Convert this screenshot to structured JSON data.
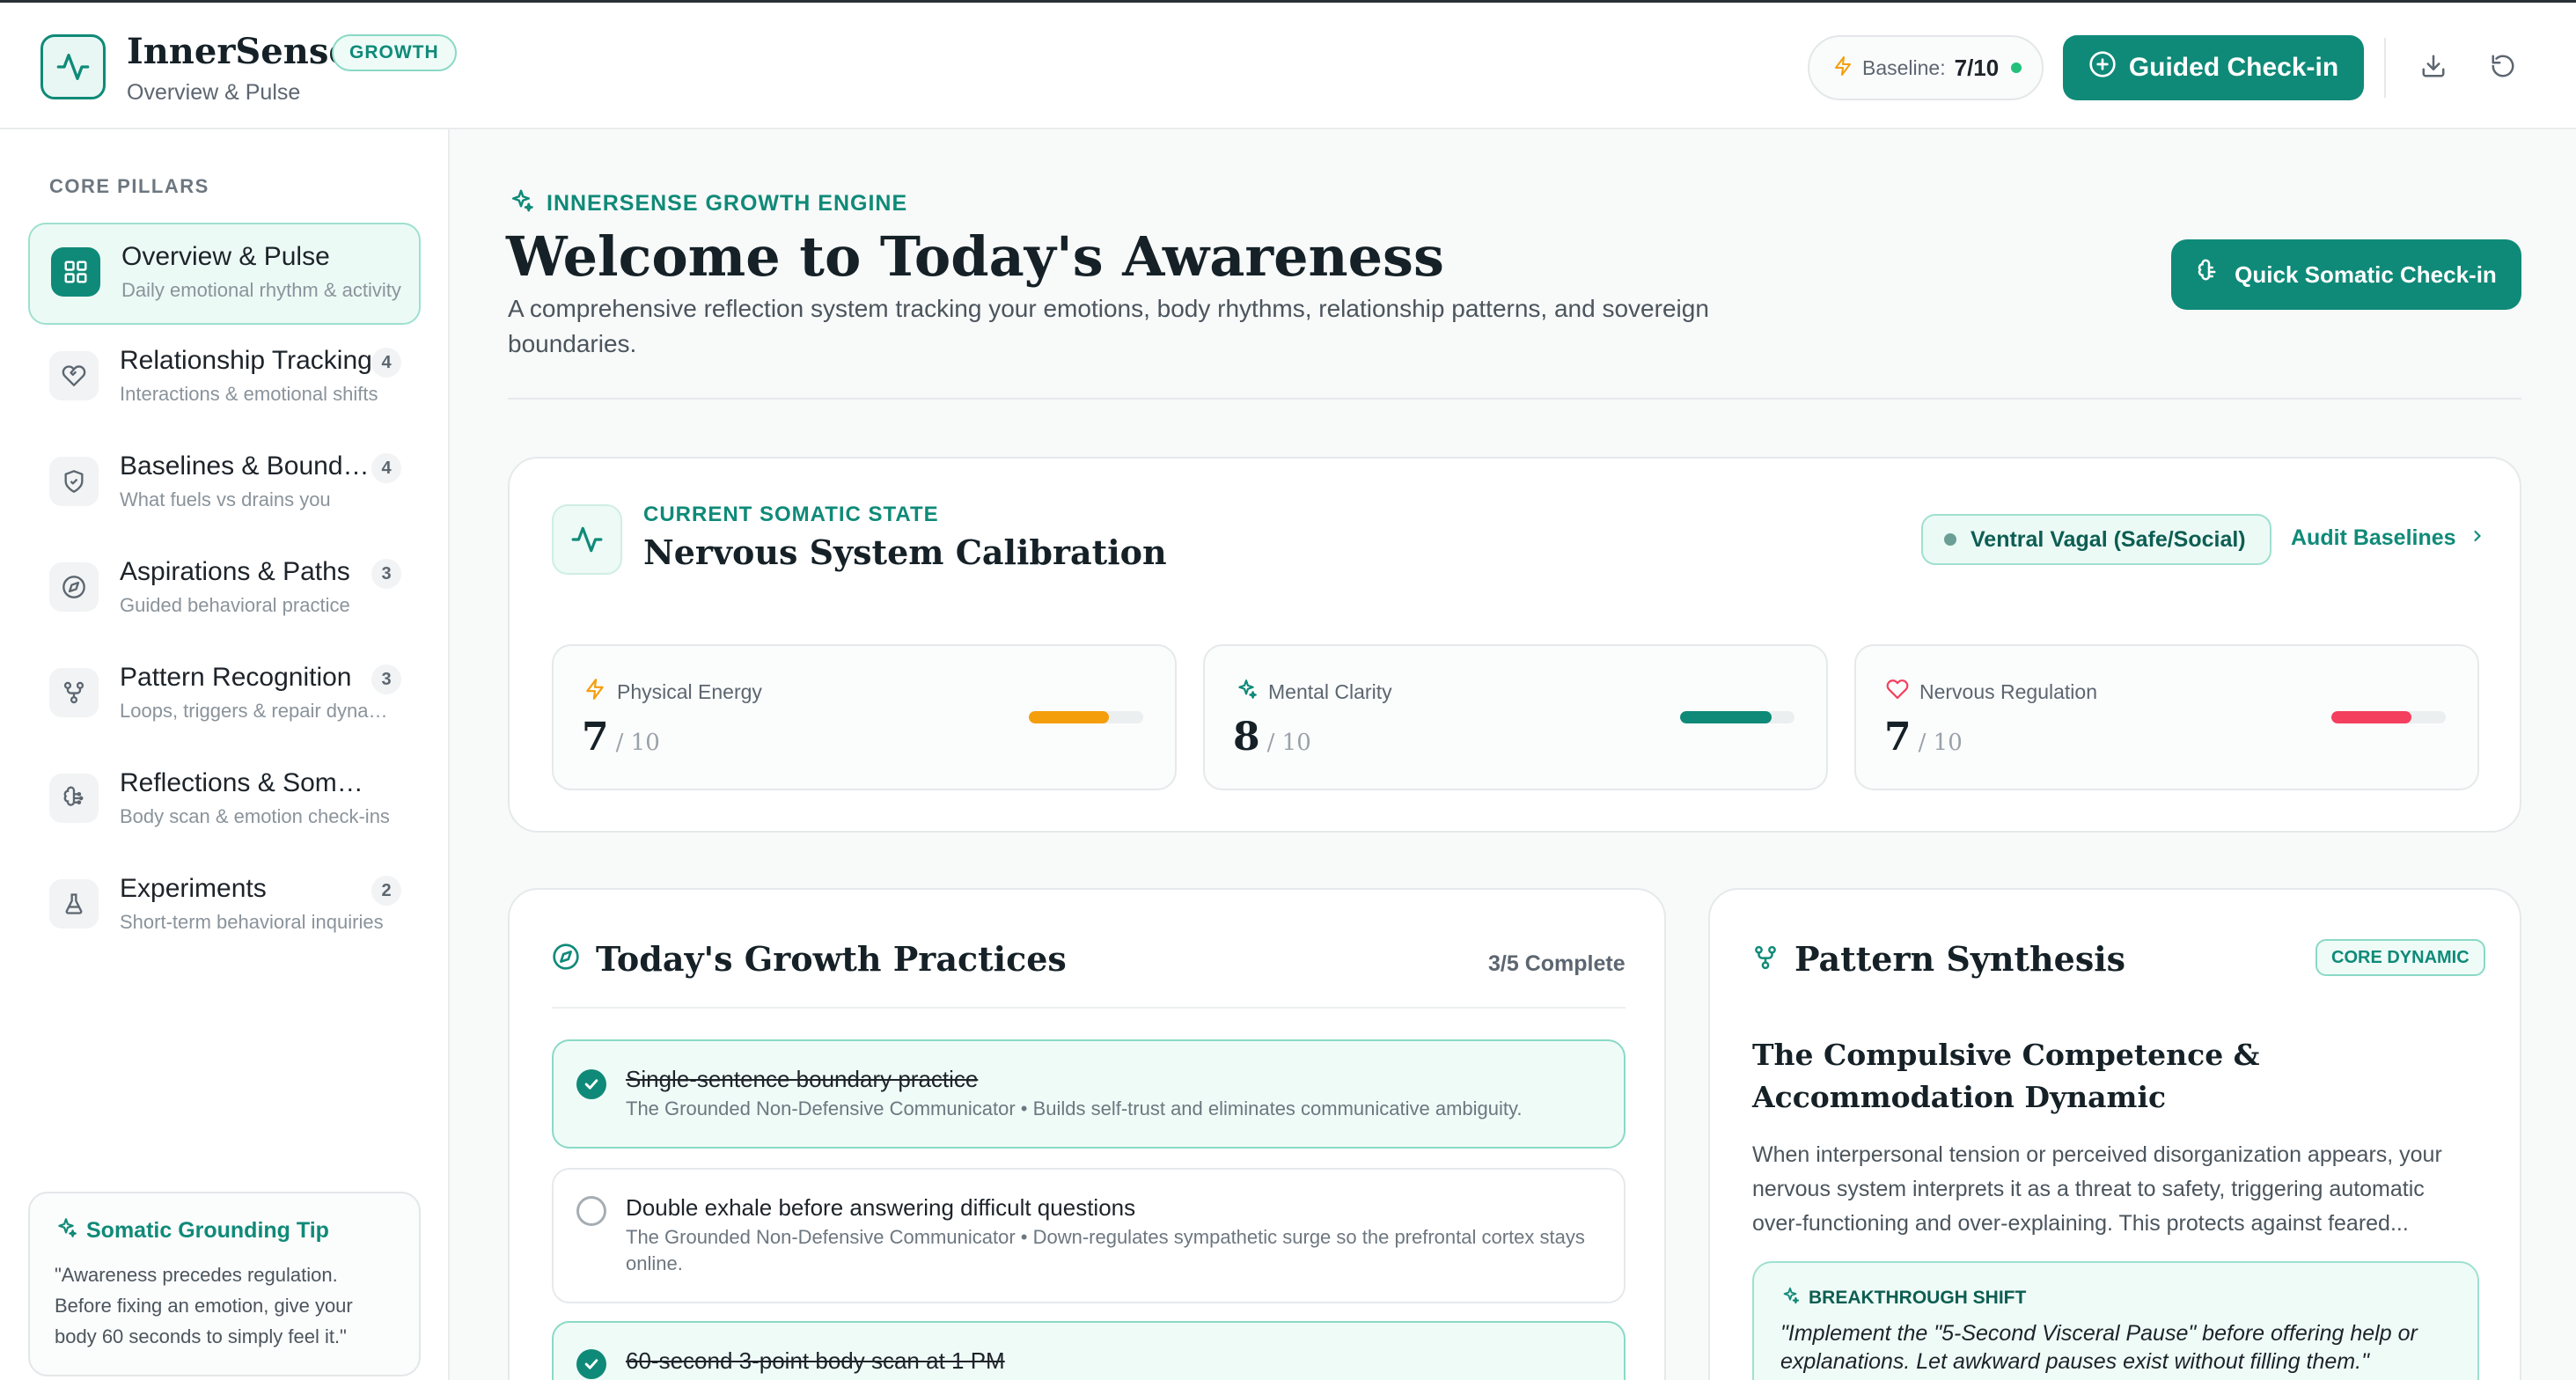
{
  "header": {
    "brand": "InnerSense",
    "badge": "GROWTH",
    "subtitle": "Overview & Pulse",
    "baseline_label": "Baseline:",
    "baseline_value": "7/10",
    "guided_button": "Guided Check-in",
    "icons": [
      "activity-icon",
      "bolt-icon",
      "plus-circle-icon",
      "download-icon",
      "refresh-icon"
    ]
  },
  "sidebar": {
    "heading": "CORE PILLARS",
    "items": [
      {
        "title": "Overview & Pulse",
        "desc": "Daily emotional rhythm & activity",
        "count": "",
        "icon": "grid-icon"
      },
      {
        "title": "Relationship Tracking",
        "desc": "Interactions & emotional shifts",
        "count": "4",
        "icon": "heart-handshake-icon"
      },
      {
        "title": "Baselines & Boundaries",
        "desc": "What fuels vs drains you",
        "count": "4",
        "icon": "shield-icon"
      },
      {
        "title": "Aspirations & Paths",
        "desc": "Guided behavioral practice",
        "count": "3",
        "icon": "compass-icon"
      },
      {
        "title": "Pattern Recognition",
        "desc": "Loops, triggers & repair dynamics",
        "count": "3",
        "icon": "git-fork-icon"
      },
      {
        "title": "Reflections & Somatics",
        "desc": "Body scan & emotion check-ins",
        "count": "",
        "icon": "brain-icon"
      },
      {
        "title": "Experiments",
        "desc": "Short-term behavioral inquiries",
        "count": "2",
        "icon": "flask-icon"
      }
    ],
    "tip": {
      "title": "Somatic Grounding Tip",
      "text": "\"Awareness precedes regulation. Before fixing an emotion, give your body 60 seconds to simply feel it.\""
    }
  },
  "main": {
    "eyebrow": "INNERSENSE GROWTH ENGINE",
    "title": "Welcome to Today's Awareness",
    "description": "A comprehensive reflection system tracking your emotions, body rhythms, relationship patterns, and sovereign boundaries.",
    "quick_button": "Quick Somatic Check-in",
    "state": {
      "eyebrow": "CURRENT SOMATIC STATE",
      "title": "Nervous System Calibration",
      "vagal": "Ventral Vagal (Safe/Social)",
      "audit": "Audit Baselines",
      "metrics": [
        {
          "label": "Physical Energy",
          "value": "7",
          "max": "/ 10",
          "fraction": 0.7,
          "color": "#f59e0b"
        },
        {
          "label": "Mental Clarity",
          "value": "8",
          "max": "/ 10",
          "fraction": 0.8,
          "color": "#0f8a78"
        },
        {
          "label": "Nervous Regulation",
          "value": "7",
          "max": "/ 10",
          "fraction": 0.7,
          "color": "#f43f5e"
        }
      ]
    },
    "practices": {
      "title": "Today's Growth Practices",
      "complete": "3/5 Complete",
      "items": [
        {
          "title": "Single-sentence boundary practice",
          "desc": "The Grounded Non-Defensive Communicator • Builds self-trust and eliminates communicative ambiguity.",
          "done": true
        },
        {
          "title": "Double exhale before answering difficult questions",
          "desc": "The Grounded Non-Defensive Communicator • Down-regulates sympathetic surge so the prefrontal cortex stays online.",
          "done": false
        },
        {
          "title": "60-second 3-point body scan at 1 PM",
          "desc": "",
          "done": true
        }
      ]
    },
    "synthesis": {
      "title": "Pattern Synthesis",
      "badge": "CORE DYNAMIC",
      "heading": "The Compulsive Competence & Accommodation Dynamic",
      "text": "When interpersonal tension or perceived disorganization appears, your nervous system interprets it as a threat to safety, triggering automatic over-functioning and over-explaining. This protects against feared...",
      "breakthrough_label": "BREAKTHROUGH SHIFT",
      "breakthrough_quote": "\"Implement the \"5-Second Visceral Pause\" before offering help or explanations. Let awkward pauses exist without filling them.\""
    }
  },
  "colors": {
    "accent": "#0f8a78",
    "energy": "#f59e0b",
    "clarity": "#0f8a78",
    "regulation": "#f43f5e"
  }
}
